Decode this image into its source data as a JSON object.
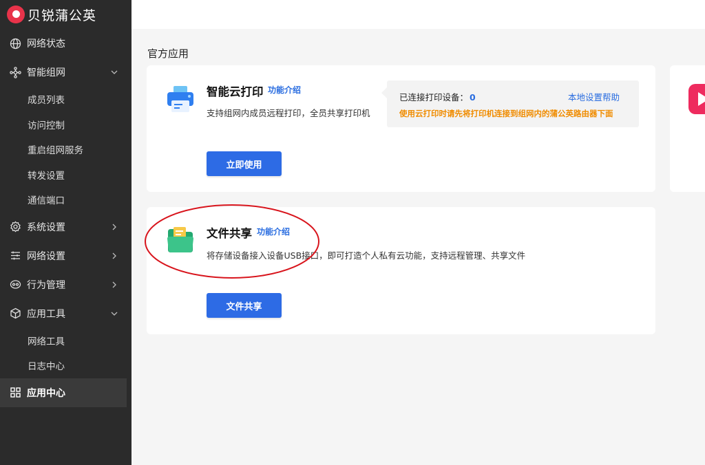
{
  "brand": {
    "name": "贝锐蒲公英",
    "accent": "#e8334a"
  },
  "sidebar": {
    "items": [
      {
        "label": "网络状态",
        "icon": "globe-icon"
      },
      {
        "label": "智能组网",
        "icon": "network-icon",
        "expanded": true,
        "children": [
          "成员列表",
          "访问控制",
          "重启组网服务",
          "转发设置",
          "通信端口"
        ]
      },
      {
        "label": "系统设置",
        "icon": "gear-icon"
      },
      {
        "label": "网络设置",
        "icon": "sliders-icon"
      },
      {
        "label": "行为管理",
        "icon": "eye-icon"
      },
      {
        "label": "应用工具",
        "icon": "cube-icon",
        "expanded": true,
        "children": [
          "网络工具",
          "日志中心"
        ]
      },
      {
        "label": "应用中心",
        "icon": "grid-icon",
        "active": true
      }
    ]
  },
  "main": {
    "section_title": "官方应用",
    "cards": [
      {
        "title": "智能云打印",
        "link": "功能介绍",
        "desc": "支持组网内成员远程打印，全员共享打印机",
        "button": "立即使用",
        "info": {
          "connected_label": "已连接打印设备：",
          "connected_count": "0",
          "help": "本地设置帮助",
          "warning": "使用云打印时请先将打印机连接到组网内的蒲公英路由器下面"
        }
      },
      {
        "title": "文件共享",
        "link": "功能介绍",
        "desc": "将存储设备接入设备USB接口，即可打造个人私有云功能，支持远程管理、共享文件",
        "button": "文件共享"
      }
    ]
  },
  "colors": {
    "primary": "#2d6be5",
    "link": "#2a6de0",
    "warning": "#f08c00",
    "annotation": "#d8141c"
  }
}
